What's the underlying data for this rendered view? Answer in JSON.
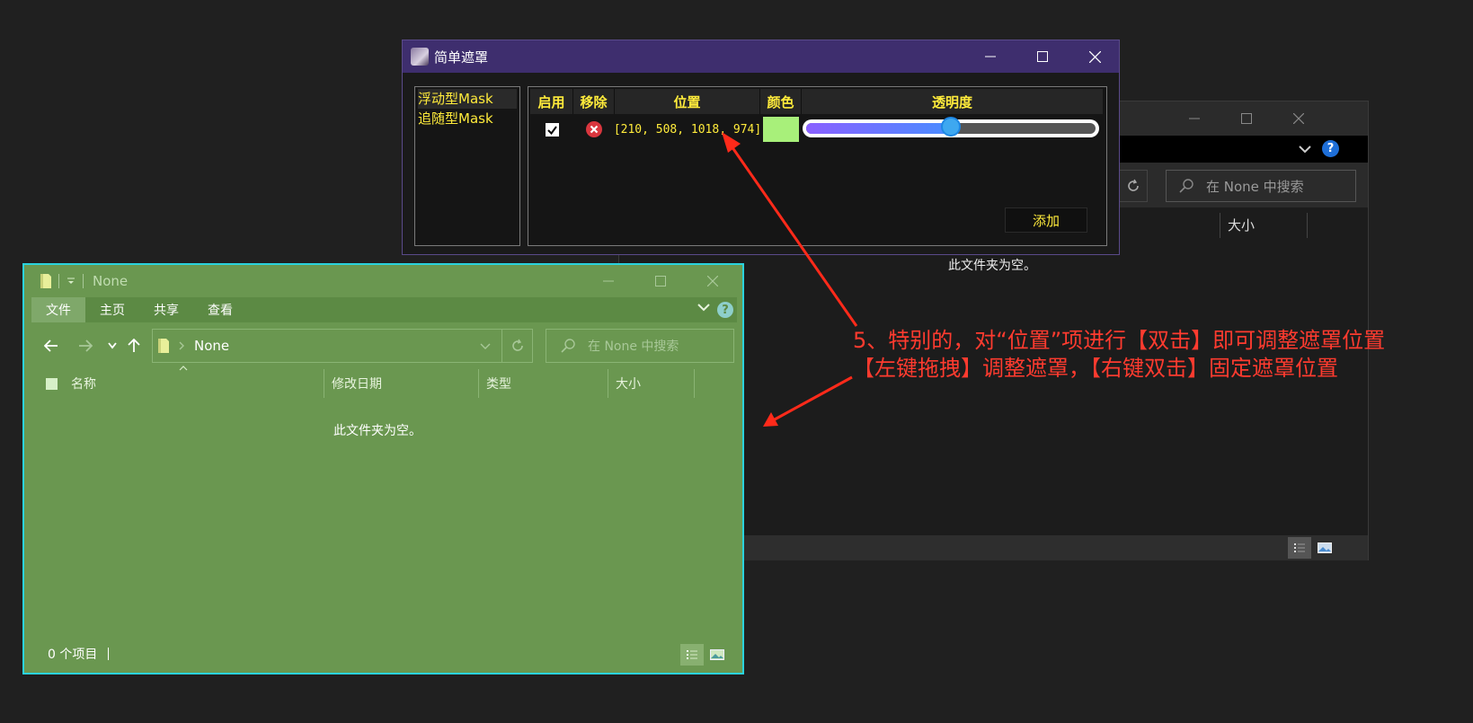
{
  "background_window": {
    "search_placeholder": "在 None 中搜索",
    "size_column": "大小",
    "empty_message": "此文件夹为空。"
  },
  "mask_dialog": {
    "title": "简单遮罩",
    "mask_types": [
      "浮动型Mask",
      "追随型Mask"
    ],
    "table": {
      "headers": {
        "enable": "启用",
        "remove": "移除",
        "position": "位置",
        "color": "颜色",
        "opacity": "透明度"
      },
      "rows": [
        {
          "enabled": true,
          "position": "[210, 508, 1018, 974]",
          "color": "#a8f07a",
          "opacity": 0.5
        }
      ]
    },
    "add_button": "添加"
  },
  "masked_explorer": {
    "title": "None",
    "ribbon_tabs": [
      "文件",
      "主页",
      "共享",
      "查看"
    ],
    "help": "?",
    "address": "None",
    "search_placeholder": "在 None 中搜索",
    "columns": [
      "名称",
      "修改日期",
      "类型",
      "大小"
    ],
    "empty_message": "此文件夹为空。",
    "status_text": "0 个项目",
    "mask_color": "#6a9750",
    "border_color": "#2ad3dd"
  },
  "annotation": {
    "line1": "5、特别的，对“位置”项进行【双击】即可调整遮罩位置",
    "line2": "【左键拖拽】调整遮罩，【右键双击】固定遮罩位置",
    "color": "#ff3b2f"
  },
  "icons": [
    "minimize-icon",
    "maximize-icon",
    "close-icon",
    "remove-icon",
    "search-icon",
    "refresh-icon",
    "folder-icon",
    "back-icon",
    "forward-icon",
    "up-icon",
    "help-icon"
  ]
}
